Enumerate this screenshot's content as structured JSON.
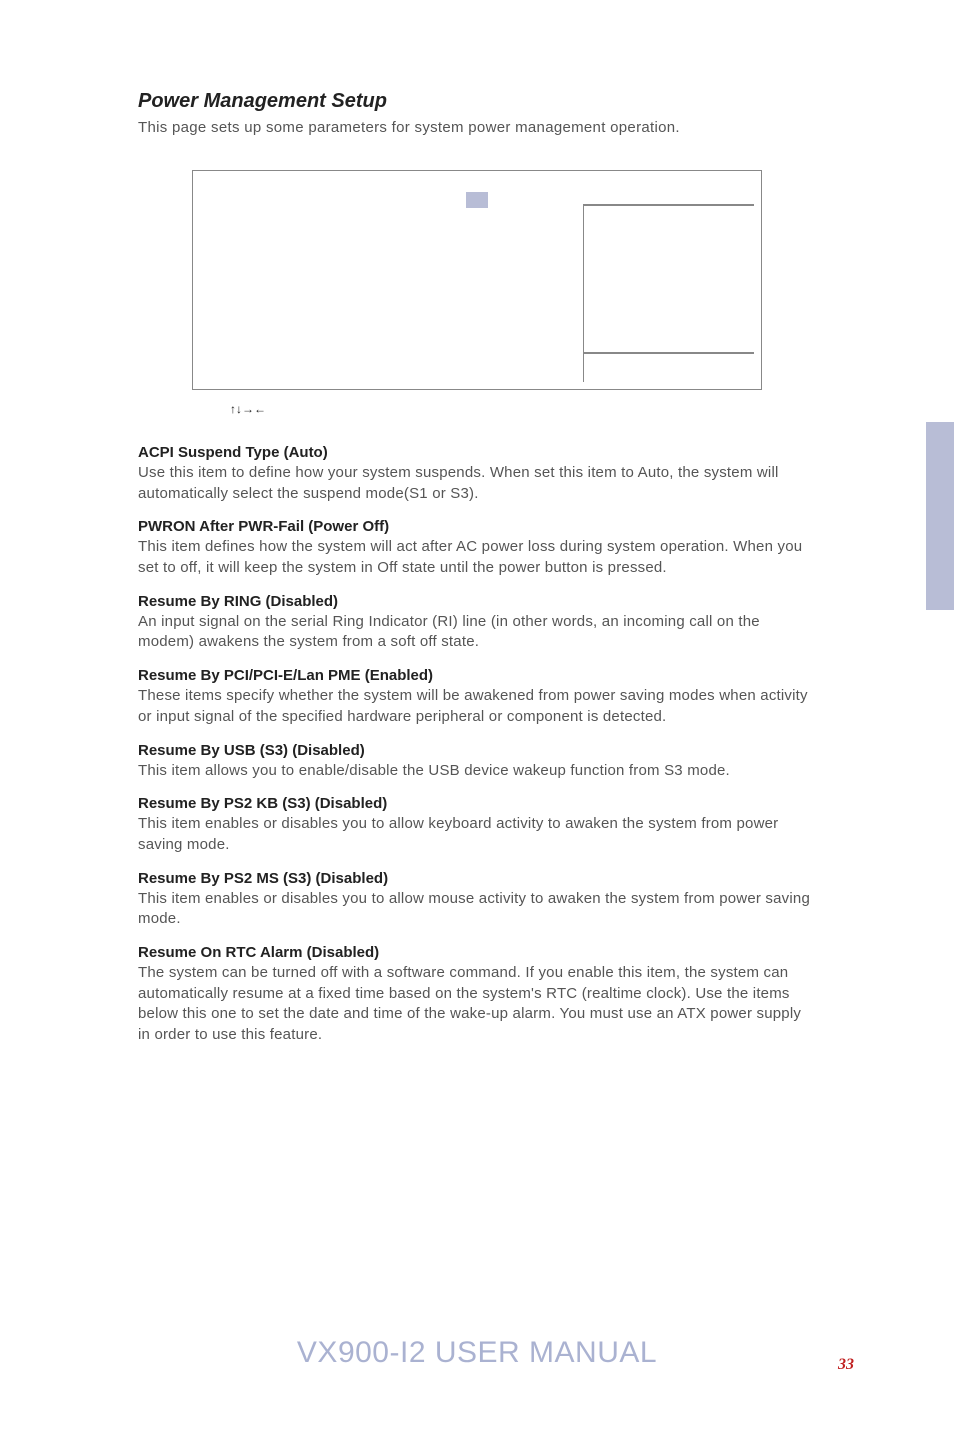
{
  "title": "Power Management Setup",
  "intro": "This page sets up some parameters for system power management operation.",
  "arrow_caption": "↑↓→←",
  "sections": [
    {
      "heading": "ACPI Suspend Type (Auto)",
      "body": "Use this item to define how your system suspends. When set this item to Auto, the system will automatically select the suspend mode(S1 or S3)."
    },
    {
      "heading": "PWRON After PWR-Fail (Power Off)",
      "body": "This item defines how the system will act after AC power loss during system operation. When you set to off, it will keep the system in Off state until the power button is pressed."
    },
    {
      "heading": "Resume By RING (Disabled)",
      "body": "An input signal on the serial Ring Indicator (RI) line (in other words, an incoming call on the modem) awakens the system from a soft off state."
    },
    {
      "heading": "Resume By PCI/PCI-E/Lan PME (Enabled)",
      "body": "These items specify whether the system will be awakened from power saving modes when activity or input signal of the specified hardware peripheral or component is detected."
    },
    {
      "heading": "Resume By USB (S3) (Disabled)",
      "body": "This item allows you to enable/disable the USB device wakeup function from S3 mode."
    },
    {
      "heading": "Resume By PS2 KB (S3) (Disabled)",
      "body": "This item enables or disables you to allow keyboard activity to awaken the system from power saving mode."
    },
    {
      "heading": "Resume By PS2 MS (S3) (Disabled)",
      "body": "This item enables or disables you to allow mouse activity to awaken the system from power saving mode."
    },
    {
      "heading": "Resume On RTC Alarm (Disabled)",
      "body": "The system can be turned off with a software command. If you enable this item, the system can automatically resume at a fixed time based on the system's RTC (realtime clock). Use the items below this one to set the date and time of the wake-up alarm. You must use an ATX power supply in order to use this feature."
    }
  ],
  "footer_title": "VX900-I2 USER MANUAL",
  "page_number": "33"
}
